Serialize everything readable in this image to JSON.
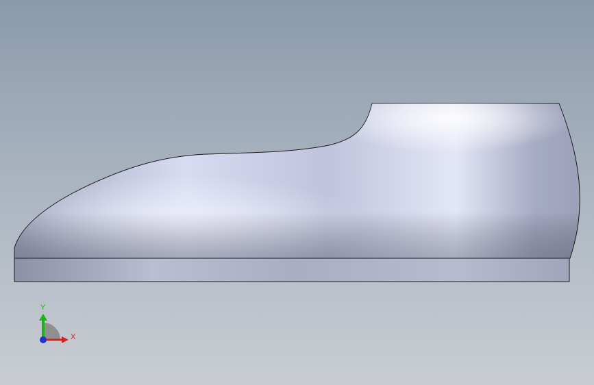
{
  "viewport": {
    "background_top": "#8a9aac",
    "background_bottom": "#c9cdd3"
  },
  "model": {
    "part": "shoe-last-solid",
    "body_color": "#c2c7df",
    "sole_color": "#aeb3c8",
    "edge_color": "#1a1a1a"
  },
  "triad": {
    "x_label": "X",
    "y_label": "Y",
    "x_color": "#d42222",
    "y_color": "#1bb21b",
    "z_color": "#2233cc"
  }
}
